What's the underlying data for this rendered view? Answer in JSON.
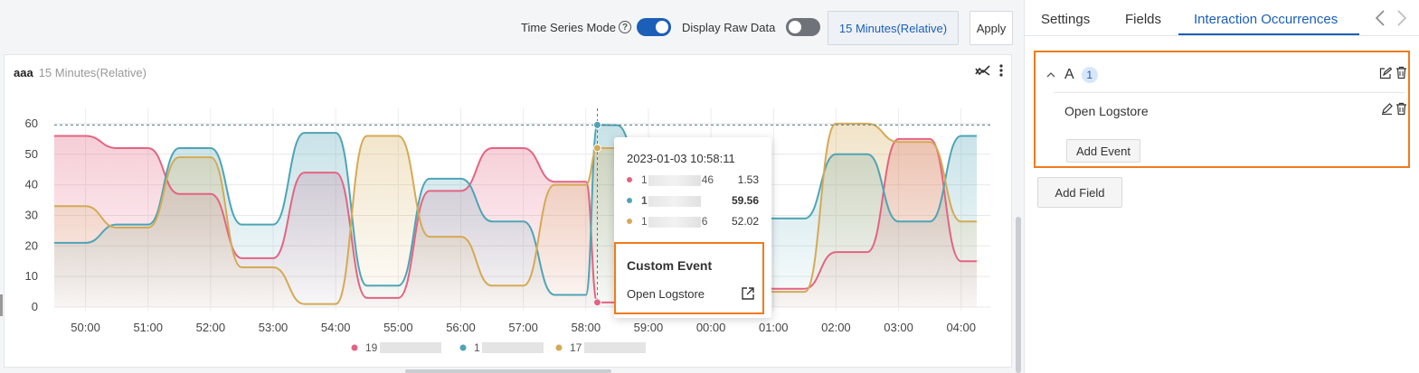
{
  "toolbar": {
    "time_series_label": "Time Series Mode",
    "raw_data_label": "Display Raw Data",
    "time_range_label": "15 Minutes(Relative)",
    "apply_label": "Apply",
    "time_series_on": true,
    "raw_data_on": false
  },
  "panel": {
    "title": "aaa",
    "subtitle": "15 Minutes(Relative)"
  },
  "chart_data": {
    "type": "area",
    "x": [
      "49:30",
      "50:00",
      "50:30",
      "51:00",
      "51:30",
      "52:00",
      "52:30",
      "53:00",
      "53:30",
      "54:00",
      "54:30",
      "55:00",
      "55:30",
      "56:00",
      "56:30",
      "57:00",
      "57:30",
      "58:00",
      "58:11",
      "58:30",
      "59:00",
      "59:30",
      "00:00",
      "00:30",
      "01:00",
      "01:30",
      "02:00",
      "02:30",
      "03:00",
      "03:30",
      "04:00",
      "04:15"
    ],
    "x_tick_labels": [
      "50:00",
      "51:00",
      "52:00",
      "53:00",
      "54:00",
      "55:00",
      "56:00",
      "57:00",
      "58:00",
      "59:00",
      "00:00",
      "01:00",
      "02:00",
      "03:00",
      "04:00"
    ],
    "y_tick_labels": [
      "0",
      "10",
      "20",
      "30",
      "40",
      "50",
      "60"
    ],
    "ylim": [
      0,
      65
    ],
    "series": [
      {
        "color": "#e36482",
        "values": [
          56,
          56,
          52,
          52,
          37,
          37,
          16,
          16,
          44,
          44,
          3,
          3,
          38,
          38,
          52,
          52,
          41,
          41,
          1.53,
          1.5,
          17,
          17,
          17,
          17,
          6,
          6,
          18,
          18,
          55,
          55,
          15,
          15
        ]
      },
      {
        "color": "#4fa4b5",
        "values": [
          21,
          21,
          27,
          27,
          52,
          52,
          27,
          27,
          57,
          57,
          7,
          7,
          42,
          42,
          28,
          28,
          4,
          4,
          59.56,
          59.5,
          33,
          33,
          31,
          31,
          29,
          29,
          50,
          50,
          28,
          28,
          56,
          56
        ]
      },
      {
        "color": "#d4aa55",
        "values": [
          33,
          33,
          26,
          26,
          49,
          49,
          13,
          13,
          1,
          1,
          56,
          56,
          23,
          23,
          7,
          7,
          40,
          40,
          52.02,
          52,
          29,
          29,
          25,
          25,
          5,
          5,
          60,
          60,
          54,
          54,
          28,
          28
        ]
      }
    ],
    "reference_line": 59.56,
    "crosshair_x": "58:11",
    "legend_colors": [
      "#e36482",
      "#4fa4b5",
      "#d4aa55"
    ],
    "legend_labels": [
      "19",
      "1",
      "17"
    ]
  },
  "tooltip": {
    "time": "2023-01-03 10:58:11",
    "rows": [
      {
        "color": "#e36482",
        "prefix": "1",
        "suffix": "46",
        "value": "1.53",
        "bold": false
      },
      {
        "color": "#4fa4b5",
        "prefix": "1",
        "suffix": "",
        "value": "59.56",
        "bold": true
      },
      {
        "color": "#d4aa55",
        "prefix": "1",
        "suffix": "6",
        "value": "52.02",
        "bold": false
      }
    ],
    "custom_event_title": "Custom Event",
    "custom_event_item": "Open Logstore"
  },
  "side": {
    "tabs": [
      {
        "label": "Settings",
        "active": false
      },
      {
        "label": "Fields",
        "active": false
      },
      {
        "label": "Interaction Occurrences",
        "active": true
      }
    ],
    "occurrence": {
      "name": "A",
      "count": "1",
      "event_label": "Open Logstore",
      "add_event_label": "Add Event"
    },
    "add_field_label": "Add Field"
  },
  "colors": {
    "accent": "#1b5fb8",
    "highlight": "#f07b1d"
  }
}
